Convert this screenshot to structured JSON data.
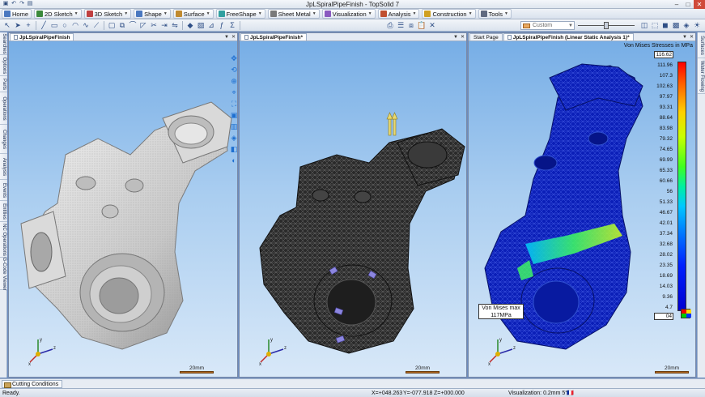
{
  "window": {
    "title": "JpLSpiralPipeFinish - TopSolid 7",
    "title_icons": [
      "save-icon",
      "undo-icon",
      "redo-icon",
      "open-icon"
    ]
  },
  "menu": {
    "items": [
      {
        "label": "Home",
        "color": "#4a78c0"
      },
      {
        "label": "2D Sketch",
        "color": "#3b8a3b"
      },
      {
        "label": "3D Sketch",
        "color": "#c04040"
      },
      {
        "label": "Shape",
        "color": "#4a78c0"
      },
      {
        "label": "Surface",
        "color": "#c08a30"
      },
      {
        "label": "FreeShape",
        "color": "#30a0a0"
      },
      {
        "label": "Sheet Metal",
        "color": "#7a7a7a"
      },
      {
        "label": "Visualization",
        "color": "#8a5ac0"
      },
      {
        "label": "Analysis",
        "color": "#c05030"
      },
      {
        "label": "Construction",
        "color": "#d0a020"
      },
      {
        "label": "Tools",
        "color": "#606a80"
      }
    ]
  },
  "toolbar": {
    "style_value": "Custom"
  },
  "left_tabs": [
    "Searches",
    "Options",
    "Parts",
    "Operations",
    "Changes",
    "Analysis",
    "Events",
    "Entities",
    "NC Operations",
    "G-Code Viewer"
  ],
  "right_tabs": [
    "Surfaces",
    "Water Flowing"
  ],
  "viewports": {
    "left": {
      "tab": "JpLSpiralPipeFinish",
      "scale_label": "20mm"
    },
    "middle": {
      "tab": "JpLSpiralPipeFinish*",
      "scale_label": "20mm"
    },
    "right": {
      "start_tab": "Start Page",
      "tab": "JpLSpiralPipeFinish (Linear Static Analysis 1)*",
      "scale_label": "20mm",
      "legend_title": "Von Mises Stresses in MPa",
      "legend_top": "116.62",
      "legend_values": [
        "111.96",
        "107.3",
        "102.63",
        "97.97",
        "93.31",
        "88.64",
        "83.98",
        "79.32",
        "74.65",
        "69.99",
        "65.33",
        "60.66",
        "56",
        "51.33",
        "46.67",
        "42.01",
        "37.34",
        "32.68",
        "28.02",
        "23.35",
        "18.69",
        "14.03",
        "9.36",
        "4.7"
      ],
      "legend_bottom": "04",
      "max_label": "Von Mises max",
      "max_value": "117MPa"
    }
  },
  "bottom_panel": {
    "tab_label": "Cutting Conditions"
  },
  "status": {
    "ready": "Ready.",
    "x": "X=+048.263",
    "y": "Y=-077.918",
    "z": "Z=+000.000",
    "visualization": "Visualization: 0.2mm 5°"
  }
}
